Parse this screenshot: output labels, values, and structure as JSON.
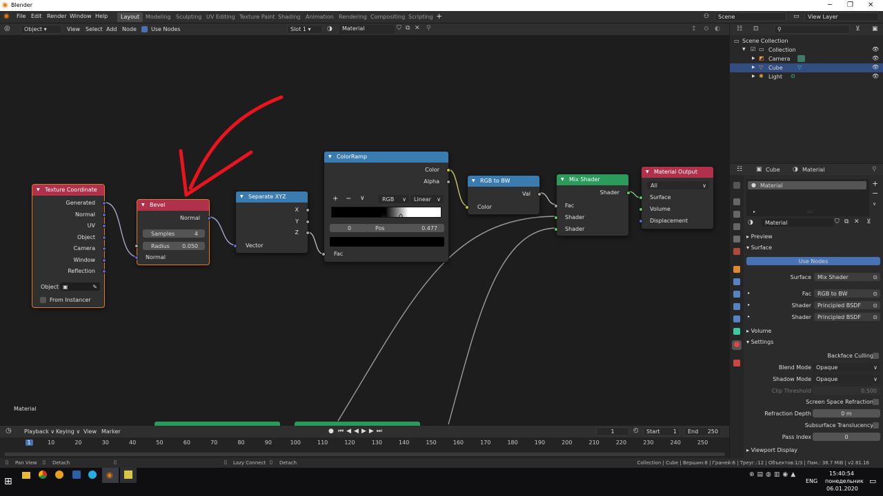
{
  "window": {
    "title": "Blender",
    "app_icon": "blender-icon"
  },
  "menu": [
    "File",
    "Edit",
    "Render",
    "Window",
    "Help"
  ],
  "workspaces": [
    "Layout",
    "Modeling",
    "Sculpting",
    "UV Editing",
    "Texture Paint",
    "Shading",
    "Animation",
    "Rendering",
    "Compositing",
    "Scripting"
  ],
  "active_workspace": "Layout",
  "top_right": {
    "scene": "Scene",
    "view_layer": "View Layer"
  },
  "editor_header": {
    "mode": "Object",
    "menus": [
      "View",
      "Select",
      "Add",
      "Node"
    ],
    "use_nodes_label": "Use Nodes",
    "slot": "Slot 1",
    "material": "Material"
  },
  "nodes": {
    "texture_coordinate": {
      "title": "Texture Coordinate",
      "outputs": [
        "Generated",
        "Normal",
        "UV",
        "Object",
        "Camera",
        "Window",
        "Reflection"
      ],
      "object_label": "Object",
      "from_instancer": "From Instancer"
    },
    "bevel": {
      "title": "Bevel",
      "output": "Normal",
      "samples_label": "Samples",
      "samples": "4",
      "radius_label": "Radius",
      "radius": "0.050",
      "input": "Normal"
    },
    "separate_xyz": {
      "title": "Separate XYZ",
      "outputs": [
        "X",
        "Y",
        "Z"
      ],
      "input": "Vector"
    },
    "color_ramp": {
      "title": "ColorRamp",
      "outputs": [
        "Color",
        "Alpha"
      ],
      "color_mode": "RGB",
      "interpolation": "Linear",
      "index": "0",
      "pos_label": "Pos",
      "pos": "0.477",
      "input": "Fac",
      "buttons": [
        "+",
        "−",
        "∨"
      ]
    },
    "rgb_to_bw": {
      "title": "RGB to BW",
      "output": "Val",
      "input": "Color"
    },
    "mix_shader": {
      "title": "Mix Shader",
      "output": "Shader",
      "inputs": [
        "Fac",
        "Shader",
        "Shader"
      ]
    },
    "material_output": {
      "title": "Material Output",
      "target": "All",
      "inputs": [
        "Surface",
        "Volume",
        "Displacement"
      ]
    }
  },
  "node_area_label": "Material",
  "timeline": {
    "menus": [
      "Playback",
      "Keying",
      "View",
      "Marker"
    ],
    "current_frame": "1",
    "start_label": "Start",
    "start": "1",
    "end_label": "End",
    "end": "250",
    "ticks": [
      "1",
      "10",
      "20",
      "30",
      "40",
      "50",
      "60",
      "70",
      "80",
      "90",
      "100",
      "110",
      "120",
      "130",
      "140",
      "150",
      "160",
      "170",
      "180",
      "190",
      "200",
      "210",
      "220",
      "230",
      "240",
      "250"
    ]
  },
  "status_bar": {
    "left": [
      "Pan View",
      "Detach"
    ],
    "middle": [
      "Lazy Connect",
      "Detach"
    ],
    "right": "Collection | Cube | Вершин:8 | Граней:6 | Треуг.:12 | Объектов:1/3 | Пам.: 38.7 MiB | v2.81.16"
  },
  "outliner": {
    "root": "Scene Collection",
    "collection": "Collection",
    "items": [
      {
        "name": "Camera",
        "selected": false
      },
      {
        "name": "Cube",
        "selected": true
      },
      {
        "name": "Light",
        "selected": false
      }
    ]
  },
  "properties": {
    "header_object": "Cube",
    "header_material": "Material",
    "slot_name": "Material",
    "material_name": "Material",
    "sections": {
      "preview": "Preview",
      "surface": "Surface",
      "volume": "Volume",
      "settings": "Settings",
      "viewport_display": "Viewport Display"
    },
    "use_nodes": "Use Nodes",
    "surface_rows": [
      {
        "label": "Surface",
        "value": "Mix Shader"
      },
      {
        "label": "Fac",
        "value": "RGB to BW"
      },
      {
        "label": "Shader",
        "value": "Principled BSDF"
      },
      {
        "label": "Shader",
        "value": "Principled BSDF"
      }
    ],
    "backface_culling": "Backface Culling",
    "blend_mode_label": "Blend Mode",
    "blend_mode": "Opaque",
    "shadow_mode_label": "Shadow Mode",
    "shadow_mode": "Opaque",
    "clip_threshold_label": "Clip Threshold",
    "clip_threshold": "0.500",
    "ssr_label": "Screen Space Refraction",
    "refraction_depth_label": "Refraction Depth",
    "refraction_depth": "0 m",
    "subsurface_label": "Subsurface Translucency",
    "pass_index_label": "Pass Index",
    "pass_index": "0"
  },
  "taskbar": {
    "lang": "ENG",
    "time": "15:40:54",
    "day": "понедельник",
    "date": "06.01.2020"
  },
  "colors": {
    "annotation_arrow": "#e8141e",
    "accent": "#4772b3",
    "selection": "#e07a23"
  }
}
